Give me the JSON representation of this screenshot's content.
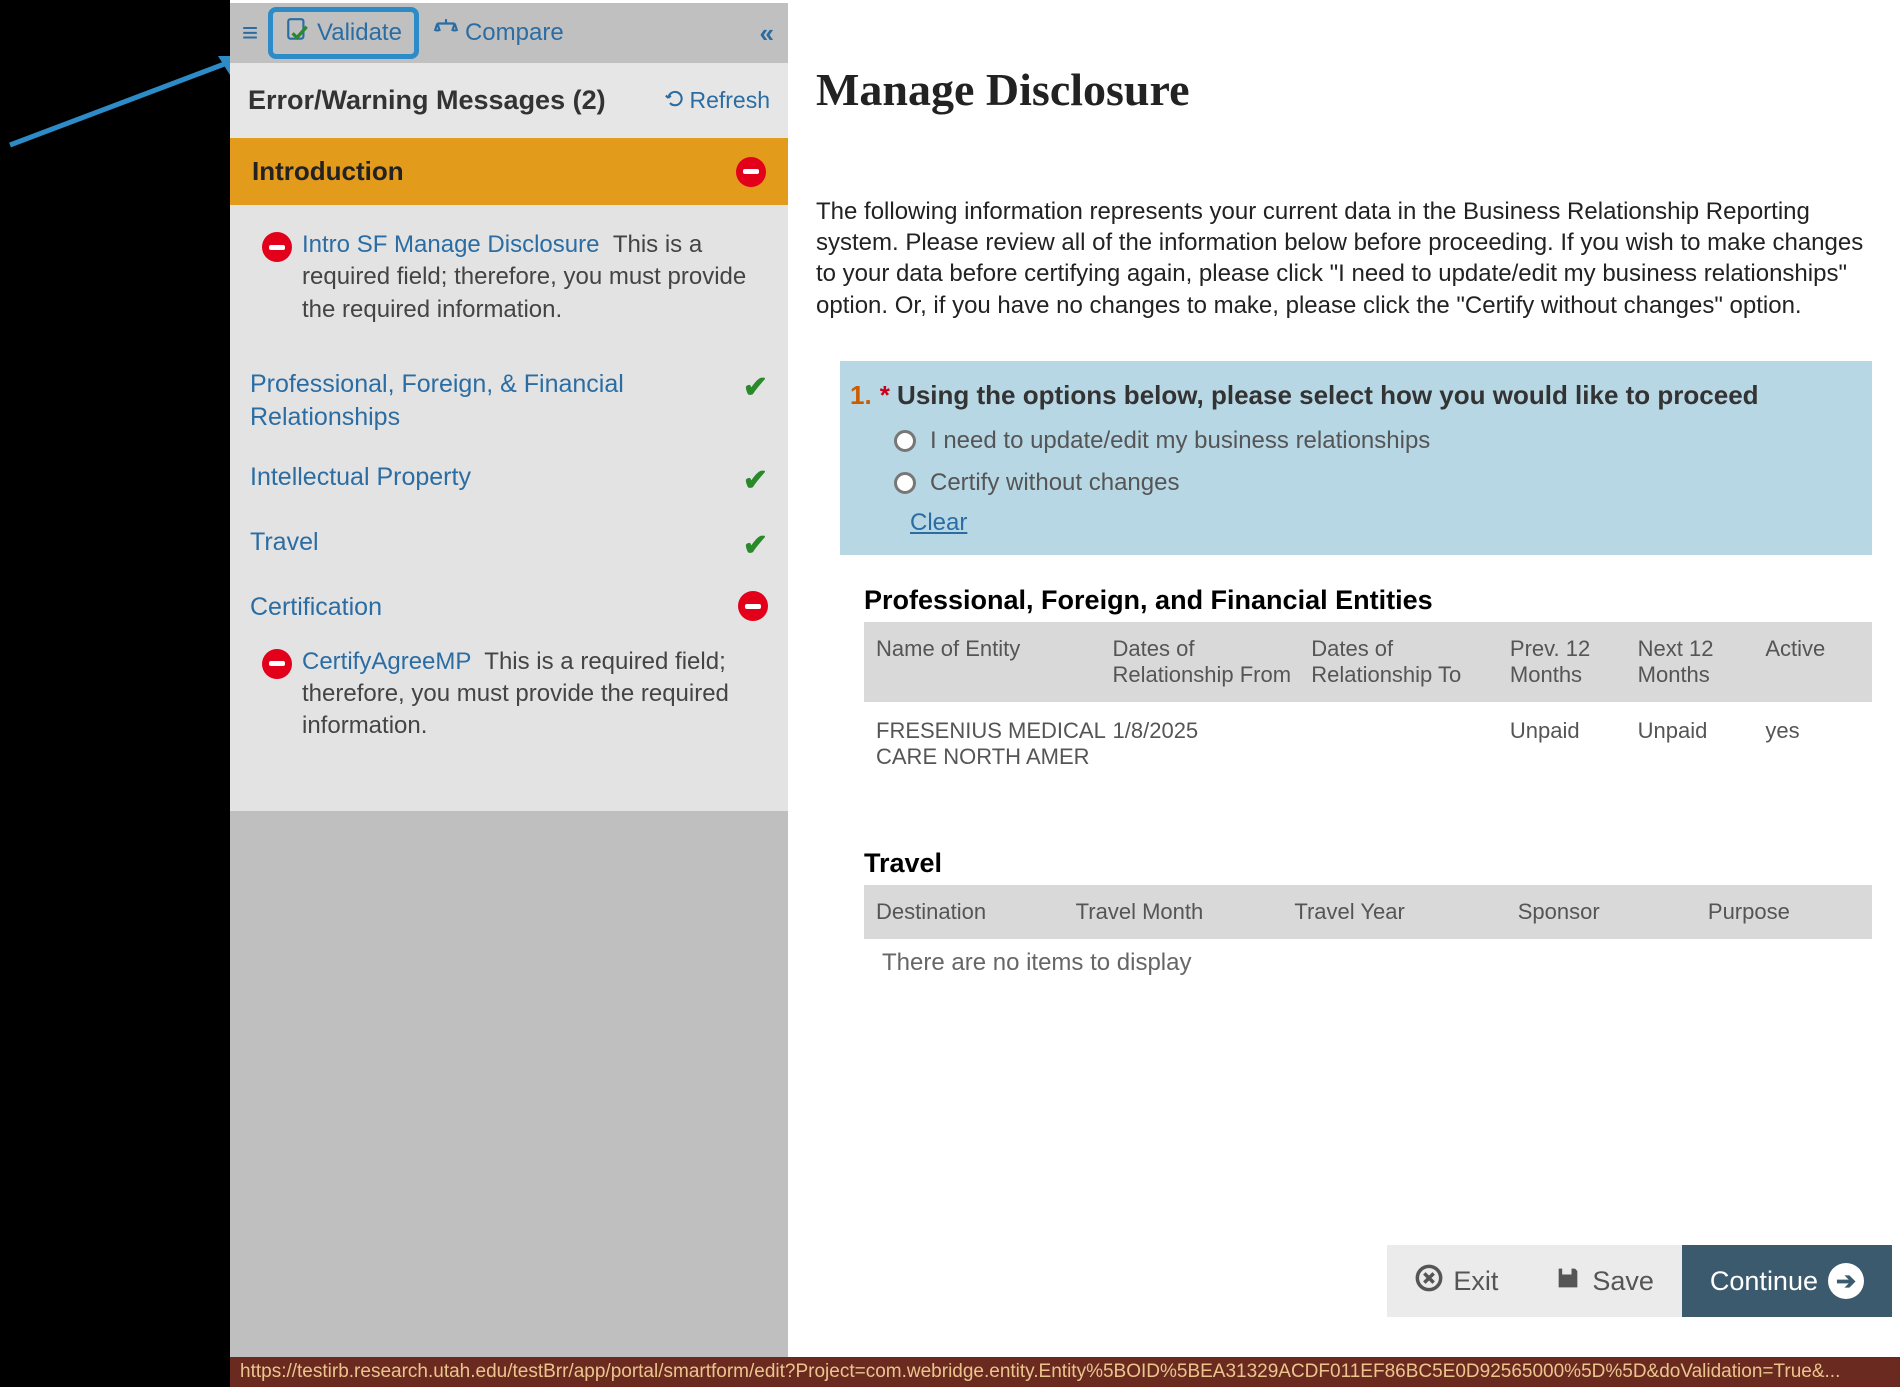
{
  "toolbar": {
    "validate": "Validate",
    "compare": "Compare",
    "collapse": "«"
  },
  "sidebar": {
    "title": "Error/Warning Messages (2)",
    "refresh": "Refresh",
    "intro_label": "Introduction",
    "intro_err_name": "Intro SF Manage Disclosure",
    "intro_err_text": "This is a required field; therefore, you must provide the required information.",
    "items": [
      {
        "label": "Professional, Foreign, & Financial Relationships",
        "status": "ok"
      },
      {
        "label": "Intellectual Property",
        "status": "ok"
      },
      {
        "label": "Travel",
        "status": "ok"
      },
      {
        "label": "Certification",
        "status": "err"
      }
    ],
    "cert_err_name": "CertifyAgreeMP",
    "cert_err_text": "This is a required field; therefore, you must provide the required information."
  },
  "main": {
    "title": "Manage Disclosure",
    "intro": "The following information represents your current data in the Business Relationship Reporting system. Please review all of the information below before proceeding. If you wish to make changes to your data before certifying again, please click \"I need to update/edit my business relationships\" option. Or, if you have no changes to make, please click the \"Certify without changes\" option.",
    "q_num": "1.",
    "q_text": "Using the options below, please select how you would like to proceed",
    "opt1": "I need to update/edit my business relationships",
    "opt2": "Certify without changes",
    "clear": "Clear",
    "pfe_title": "Professional, Foreign, and Financial Entities",
    "pfe_headers": [
      "Name of Entity",
      "Dates of Relationship From",
      "Dates of Relationship To",
      "Prev. 12 Months",
      "Next 12 Months",
      "Active"
    ],
    "pfe_rows": [
      {
        "c1": "FRESENIUS MEDICAL CARE NORTH AMER",
        "c2": "1/8/2025",
        "c3": "",
        "c4": "Unpaid",
        "c5": "Unpaid",
        "c6": "yes"
      }
    ],
    "travel_title": "Travel",
    "travel_headers": [
      "Destination",
      "Travel Month",
      "Travel Year",
      "Sponsor",
      "Purpose"
    ],
    "travel_empty": "There are no items to display"
  },
  "footer": {
    "exit": "Exit",
    "save": "Save",
    "continue": "Continue"
  },
  "status_url": "https://testirb.research.utah.edu/testBrr/app/portal/smartform/edit?Project=com.webridge.entity.Entity%5BOID%5BEA31329ACDF011EF86BC5E0D92565000%5D%5D&doValidation=True&..."
}
